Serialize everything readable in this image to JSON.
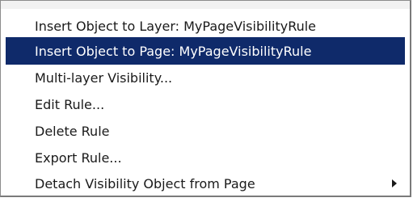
{
  "menu": {
    "highlight_color": "#0f2a6a",
    "items": [
      {
        "label": "Insert Object to Layer: MyPageVisibilityRule"
      },
      {
        "label": "Insert Object to Page: MyPageVisibilityRule"
      },
      {
        "label": "Multi-layer Visibility..."
      },
      {
        "label": "Edit Rule..."
      },
      {
        "label": "Delete Rule"
      },
      {
        "label": "Export Rule..."
      },
      {
        "label": "Detach Visibility Object from Page",
        "submenu_icon": "chevron-right-icon"
      }
    ]
  }
}
